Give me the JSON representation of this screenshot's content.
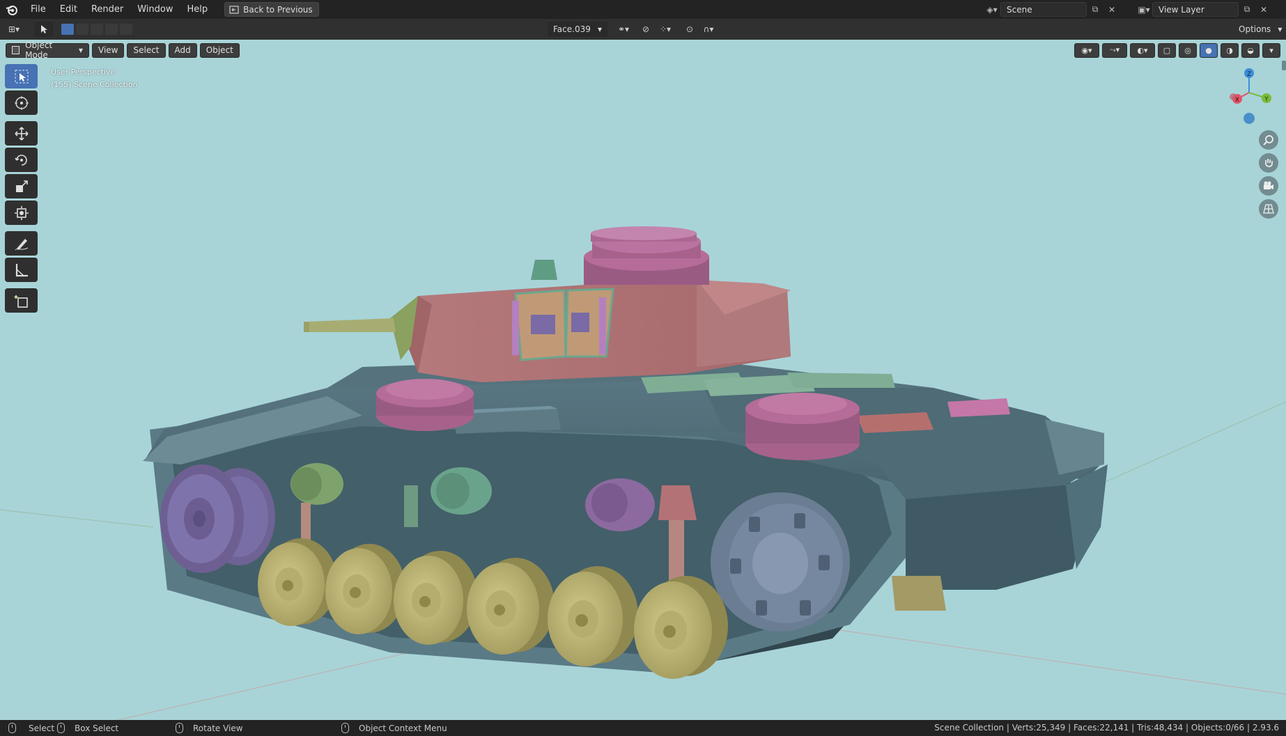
{
  "menu": {
    "items": [
      "File",
      "Edit",
      "Render",
      "Window",
      "Help"
    ],
    "back_button": "Back to Previous"
  },
  "scene": {
    "label": "Scene"
  },
  "view_layer": {
    "label": "View Layer"
  },
  "header": {
    "active_object": "Face.039",
    "options": "Options"
  },
  "viewport_header": {
    "mode": "Object Mode",
    "menus": [
      "View",
      "Select",
      "Add",
      "Object"
    ]
  },
  "overlay": {
    "perspective": "User Perspective",
    "collection": "(155) Scene Collection"
  },
  "gizmo": {
    "x": "X",
    "y": "Y",
    "z": "Z"
  },
  "toolbar_tools": [
    {
      "icon": "select-box-icon",
      "active": true
    },
    {
      "icon": "cursor-icon",
      "active": false
    },
    {
      "icon": "move-icon",
      "active": false
    },
    {
      "icon": "rotate-icon",
      "active": false
    },
    {
      "icon": "scale-icon",
      "active": false
    },
    {
      "icon": "transform-icon",
      "active": false
    },
    {
      "icon": "annotate-icon",
      "active": false
    },
    {
      "icon": "measure-icon",
      "active": false
    },
    {
      "icon": "add-cube-icon",
      "active": false
    }
  ],
  "status": {
    "select": "Select",
    "box_select": "Box Select",
    "rotate_view": "Rotate View",
    "context_menu": "Object Context Menu",
    "stats": "Scene Collection | Verts:25,349 | Faces:22,141 | Tris:48,434 | Objects:0/66 | 2.93.6"
  },
  "colors": {
    "viewport_bg": "#a8d4d8",
    "hull": "#4f6d77",
    "turret": "#b06e72",
    "wheels": "#b9b276",
    "purple_parts": "#8c6a9a",
    "green_parts": "#6fa38b",
    "accent": "#4772b3"
  }
}
